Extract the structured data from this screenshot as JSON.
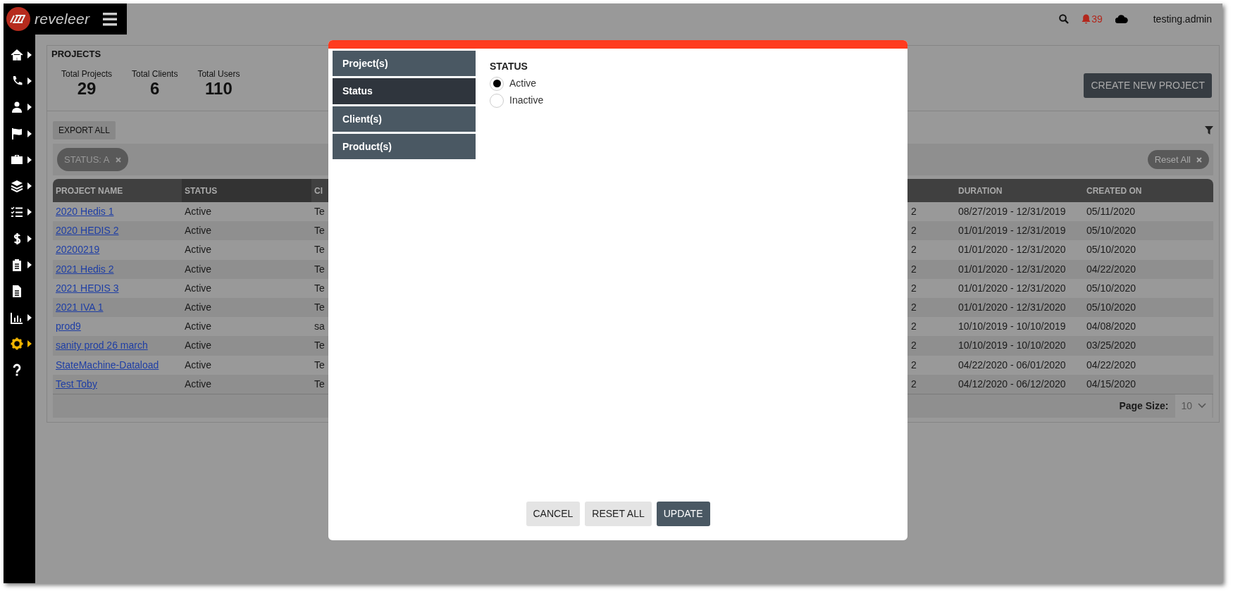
{
  "app": {
    "logo": "reveleer",
    "notifications": "39",
    "user": "testing.admin"
  },
  "sidebar": {
    "items": [
      {
        "kind": "home",
        "caret": true,
        "selected": false
      },
      {
        "kind": "phone",
        "caret": true,
        "selected": false
      },
      {
        "kind": "user",
        "caret": true,
        "selected": false
      },
      {
        "kind": "flag",
        "caret": true,
        "selected": false
      },
      {
        "kind": "briefcase",
        "caret": true,
        "selected": false
      },
      {
        "kind": "layers",
        "caret": true,
        "selected": false
      },
      {
        "kind": "list",
        "caret": true,
        "selected": false
      },
      {
        "kind": "dollar",
        "caret": true,
        "selected": false
      },
      {
        "kind": "clipboard",
        "caret": true,
        "selected": false
      },
      {
        "kind": "file",
        "caret": false,
        "selected": false
      },
      {
        "kind": "chart",
        "caret": true,
        "selected": false
      },
      {
        "kind": "gear",
        "caret": true,
        "selected": true
      },
      {
        "kind": "help",
        "caret": false,
        "selected": false
      }
    ]
  },
  "projects": {
    "title": "PROJECTS",
    "stats": [
      {
        "label": "Total Projects",
        "value": "29"
      },
      {
        "label": "Total Clients",
        "value": "6"
      },
      {
        "label": "Total Users",
        "value": "110"
      }
    ],
    "create_button": "CREATE NEW PROJECT",
    "export_button": "EXPORT ALL",
    "filter_chips": [
      {
        "label": "STATUS: A"
      }
    ],
    "reset_button": "Reset All"
  },
  "table": {
    "columns": [
      {
        "label": "PROJECT NAME",
        "sorted": false
      },
      {
        "label": "STATUS",
        "sorted": true
      },
      {
        "label": "Cl",
        "sorted": false
      },
      {
        "sorted": false
      },
      {
        "label": "DURATION",
        "sorted": false
      },
      {
        "label": "CREATED ON",
        "sorted": false
      }
    ],
    "rows": [
      [
        "2020 Hedis 1",
        "Active",
        "Te",
        "2",
        "08/27/2019 - 12/31/2019",
        "05/11/2020"
      ],
      [
        "2020 HEDIS 2",
        "Active",
        "Te",
        "2",
        "01/01/2019 - 12/31/2019",
        "05/10/2020"
      ],
      [
        "20200219",
        "Active",
        "Te",
        "2",
        "01/01/2020 - 12/31/2020",
        "05/10/2020"
      ],
      [
        "2021 Hedis 2",
        "Active",
        "Te",
        "2",
        "01/01/2020 - 12/31/2020",
        "04/22/2020"
      ],
      [
        "2021 HEDIS 3",
        "Active",
        "Te",
        "2",
        "01/01/2020 - 12/31/2020",
        "05/10/2020"
      ],
      [
        "2021 IVA 1",
        "Active",
        "Te",
        "2",
        "01/01/2020 - 12/31/2020",
        "05/10/2020"
      ],
      [
        "prod9",
        "Active",
        "sa",
        "2",
        "10/10/2019 - 10/10/2019",
        "04/08/2020"
      ],
      [
        "sanity prod 26 march",
        "Active",
        "Te",
        "2",
        "10/10/2019 - 10/10/2020",
        "03/25/2020"
      ],
      [
        "StateMachine-Dataload",
        "Active",
        "Te",
        "2",
        "04/22/2020 - 06/01/2020",
        "04/22/2020"
      ],
      [
        "Test Toby",
        "Active",
        "Te",
        "2",
        "04/12/2020 - 06/12/2020",
        "04/15/2020"
      ]
    ],
    "page_size_label": "Page Size:",
    "page_size": "10"
  },
  "modal": {
    "tabs": [
      {
        "label": "Project(s)",
        "selected": false
      },
      {
        "label": "Status",
        "selected": true
      },
      {
        "label": "Client(s)",
        "selected": false
      },
      {
        "label": "Product(s)",
        "selected": false
      }
    ],
    "section_title": "STATUS",
    "options": [
      {
        "label": "Active",
        "selected": true
      },
      {
        "label": "Inactive",
        "selected": false
      }
    ],
    "buttons": [
      {
        "label": "CANCEL",
        "kind": "secondary"
      },
      {
        "label": "RESET ALL",
        "kind": "secondary"
      },
      {
        "label": "UPDATE",
        "kind": "primary"
      }
    ]
  }
}
